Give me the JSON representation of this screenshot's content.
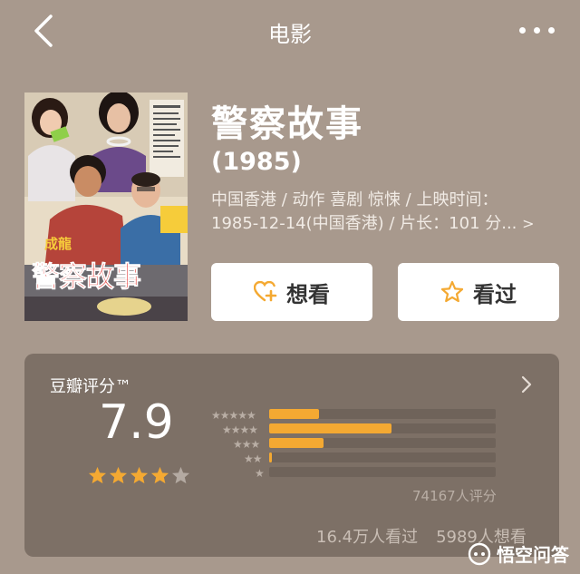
{
  "header": {
    "title": "电影"
  },
  "poster": {
    "caption_top": "成龍",
    "caption_main": "警察故事"
  },
  "movie": {
    "title": "警察故事",
    "year": "(1985)",
    "meta_line1": "中国香港 / 动作 喜剧 惊悚 / 上映时间：",
    "meta_line2": "1985-12-14(中国香港) / 片长：101 分...",
    "meta_more": ">"
  },
  "actions": {
    "want_label": "想看",
    "seen_label": "看过"
  },
  "rating": {
    "label": "豆瓣评分™",
    "score": "7.9",
    "stars_filled": 4,
    "stars_total": 5,
    "distribution": [
      {
        "stars": "★★★★★",
        "fraction": 0.22
      },
      {
        "stars": "★★★★",
        "fraction": 0.54
      },
      {
        "stars": "★★★",
        "fraction": 0.24
      },
      {
        "stars": "★★",
        "fraction": 0.01
      },
      {
        "stars": "★",
        "fraction": 0.0
      }
    ],
    "count_text": "74167人评分",
    "seen_text": "16.4万人看过",
    "want_text": "5989人想看"
  },
  "watermark": {
    "text": "悟空问答"
  },
  "colors": {
    "accent": "#f4a932",
    "background": "#a8998d",
    "card": "#7d7066"
  },
  "icons": {
    "back": "back-chevron-icon",
    "more": "more-dots-icon",
    "want": "heart-plus-icon",
    "seen": "star-outline-icon"
  }
}
